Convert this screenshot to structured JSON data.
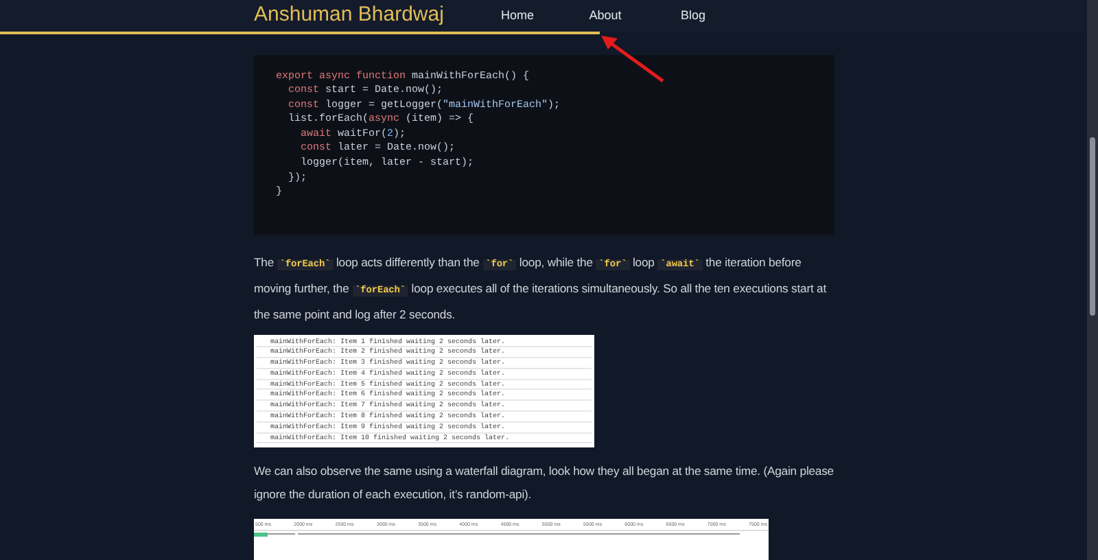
{
  "header": {
    "title": "Anshuman Bhardwaj",
    "nav": [
      {
        "label": "Home"
      },
      {
        "label": "About"
      },
      {
        "label": "Blog"
      }
    ]
  },
  "code_block": {
    "lines": [
      [
        {
          "kind": "keyword",
          "text": "export async function "
        },
        {
          "kind": "plain",
          "text": "mainWithForEach() {"
        }
      ],
      [
        {
          "kind": "keyword",
          "text": "  const "
        },
        {
          "kind": "plain",
          "text": "start = Date.now();"
        }
      ],
      [
        {
          "kind": "keyword",
          "text": "  const "
        },
        {
          "kind": "plain",
          "text": "logger = getLogger("
        },
        {
          "kind": "string",
          "text": "\"mainWithForEach\""
        },
        {
          "kind": "plain",
          "text": ");"
        }
      ],
      [
        {
          "kind": "plain",
          "text": "  list.forEach("
        },
        {
          "kind": "keyword",
          "text": "async "
        },
        {
          "kind": "plain",
          "text": "(item) => {"
        }
      ],
      [
        {
          "kind": "keyword",
          "text": "    await "
        },
        {
          "kind": "plain",
          "text": "waitFor("
        },
        {
          "kind": "number",
          "text": "2"
        },
        {
          "kind": "plain",
          "text": ");"
        }
      ],
      [
        {
          "kind": "keyword",
          "text": "    const "
        },
        {
          "kind": "plain",
          "text": "later = Date.now();"
        }
      ],
      [
        {
          "kind": "plain",
          "text": "    logger(item, later - start);"
        }
      ],
      [
        {
          "kind": "plain",
          "text": "  });"
        }
      ],
      [
        {
          "kind": "plain",
          "text": "}"
        }
      ]
    ]
  },
  "paragraph_1": [
    {
      "kind": "text",
      "text": "The "
    },
    {
      "kind": "code",
      "text": "`forEach`"
    },
    {
      "kind": "text",
      "text": " loop acts differently than the "
    },
    {
      "kind": "code",
      "text": "`for`"
    },
    {
      "kind": "text",
      "text": " loop, while the "
    },
    {
      "kind": "code",
      "text": "`for`"
    },
    {
      "kind": "text",
      "text": " loop "
    },
    {
      "kind": "code",
      "text": "`await`"
    },
    {
      "kind": "text",
      "text": " the iteration before moving further, the "
    },
    {
      "kind": "code",
      "text": "`forEach`"
    },
    {
      "kind": "text",
      "text": " loop executes all of the iterations simultaneously. So all the ten executions start at the same point and log after 2 seconds."
    }
  ],
  "console_log": [
    "mainWithForEach: Item 1 finished waiting 2 seconds later.",
    "mainWithForEach: Item 2 finished waiting 2 seconds later.",
    "mainWithForEach: Item 3 finished waiting 2 seconds later.",
    "mainWithForEach: Item 4 finished waiting 2 seconds later.",
    "mainWithForEach: Item 5 finished waiting 2 seconds later.",
    "mainWithForEach: Item 6 finished waiting 2 seconds later.",
    "mainWithForEach: Item 7 finished waiting 2 seconds later.",
    "mainWithForEach: Item 8 finished waiting 2 seconds later.",
    "mainWithForEach: Item 9 finished waiting 2 seconds later.",
    "mainWithForEach: Item 10 finished waiting 2 seconds later."
  ],
  "paragraph_2": "We can also observe the same using a waterfall diagram, look how they all began at the same time. (Again please ignore the duration of each execution, it’s random-api).",
  "waterfall": {
    "ticks": [
      "500 ms",
      "2000 ms",
      "2500 ms",
      "3000 ms",
      "3500 ms",
      "4000 ms",
      "4500 ms",
      "5000 ms",
      "5500 ms",
      "6000 ms",
      "6500 ms",
      "7000 ms",
      "7500 ms"
    ]
  }
}
